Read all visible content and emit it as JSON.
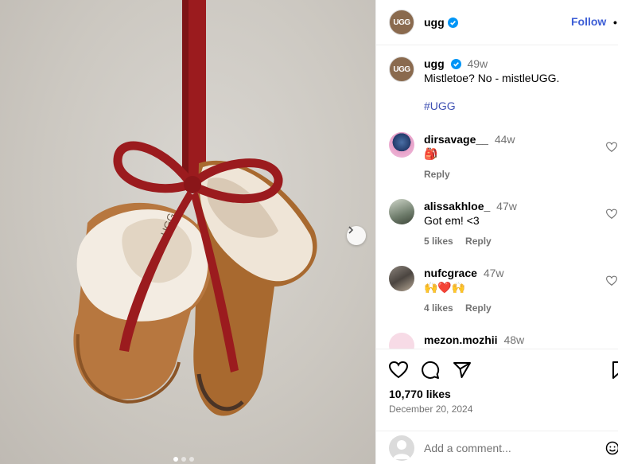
{
  "account": {
    "username": "ugg",
    "avatar_text": "UGG",
    "follow_label": "Follow",
    "more_label": "•••"
  },
  "post": {
    "time_ago": "49w",
    "caption": "Mistletoe? No - mistleUGG.",
    "hashtag": "#UGG",
    "likes": "10,770 likes",
    "date": "December 20, 2024"
  },
  "comments": [
    {
      "user": "dirsavage__",
      "time": "44w",
      "text": "🎒",
      "likes": "",
      "reply": "Reply"
    },
    {
      "user": "alissakhloe_",
      "time": "47w",
      "text": "Got em! <3",
      "likes": "5 likes",
      "reply": "Reply"
    },
    {
      "user": "nufcgrace",
      "time": "47w",
      "text": "🙌❤️🙌",
      "likes": "4 likes",
      "reply": "Reply"
    },
    {
      "user": "mezon.mozhii",
      "time": "48w",
      "text": "",
      "likes": "",
      "reply": ""
    }
  ],
  "composer": {
    "placeholder": "Add a comment..."
  },
  "photo": {
    "brand_label": "UGG"
  },
  "colors": {
    "ribbon": "#9b1b1e",
    "suede": "#b7773f",
    "fleece": "#f3ece2",
    "link": "#3d4fb2",
    "verified": "#0095f6"
  },
  "icons": [
    "verified-badge-icon",
    "heart-icon",
    "comment-icon",
    "share-icon",
    "bookmark-icon",
    "emoji-icon",
    "chevron-right-icon"
  ]
}
